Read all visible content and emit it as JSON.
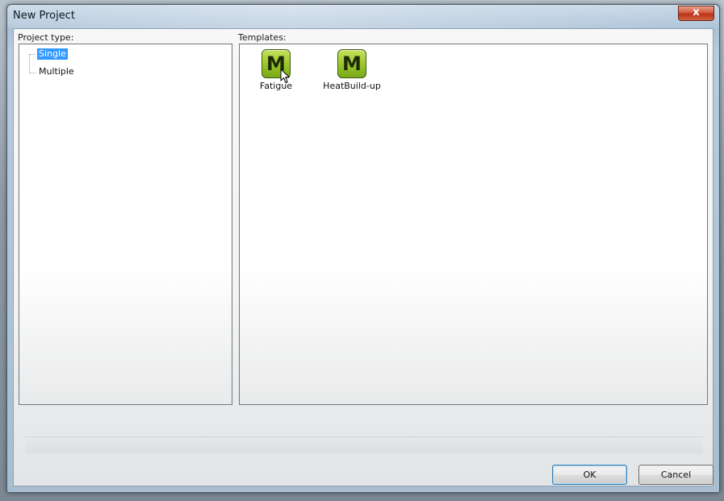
{
  "window": {
    "title": "New Project",
    "close_label": "x"
  },
  "project_type": {
    "label": "Project type:",
    "items": [
      {
        "label": "Single",
        "selected": true
      },
      {
        "label": "Multiple",
        "selected": false
      }
    ]
  },
  "templates": {
    "label": "Templates:",
    "items": [
      {
        "icon_letter": "M",
        "label": "Fatigue"
      },
      {
        "icon_letter": "M",
        "label": "HeatBuild-up"
      }
    ]
  },
  "buttons": {
    "ok_label": "OK",
    "cancel_label": "Cancel"
  },
  "colors": {
    "selection": "#3399ff",
    "template_icon": "#9ac82c",
    "close_button": "#d25a3c"
  }
}
